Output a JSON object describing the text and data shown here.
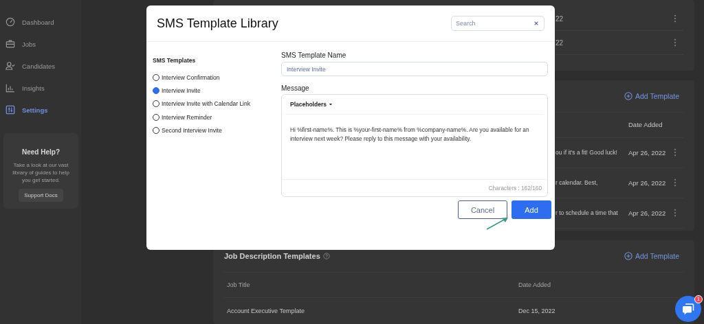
{
  "sidebar": {
    "items": [
      {
        "label": "Dashboard",
        "kind": "dashboard",
        "selected": false
      },
      {
        "label": "Jobs",
        "kind": "jobs",
        "selected": false
      },
      {
        "label": "Candidates",
        "kind": "candidates",
        "selected": false
      },
      {
        "label": "Insights",
        "kind": "insights",
        "selected": false
      },
      {
        "label": "Settings",
        "kind": "settings",
        "selected": true
      }
    ],
    "help_card": {
      "title": "Need Help?",
      "text": "Take a look at our vast library of guides to help you get started.",
      "button": "Support Docs"
    }
  },
  "top_table": {
    "rows": [
      {
        "date": "22"
      },
      {
        "date": "22"
      }
    ]
  },
  "sms_templates_section": {
    "add_button": "Add Template",
    "columns": [
      "Date Added"
    ],
    "rows": [
      {
        "message": "ou if it's a fit! Good luck!",
        "date": "Apr 26, 2022"
      },
      {
        "message": "r calendar. Best,",
        "date": "Apr 26, 2022"
      },
      {
        "message": "r to schedule a time that",
        "date": "Apr 26, 2022"
      }
    ]
  },
  "job_description_templates": {
    "title": "Job Description Templates",
    "add_button": "Add Template",
    "columns": [
      "Job Title",
      "Date Added"
    ],
    "rows": [
      {
        "job_title": "Account Executive Template",
        "date": "Dec 15, 2022"
      }
    ]
  },
  "modal": {
    "title": "SMS Template Library",
    "search": {
      "placeholder": "Search"
    },
    "list_title": "SMS Templates",
    "templates": [
      {
        "label": "Interview Confirmation",
        "selected": false
      },
      {
        "label": "Interview Invite",
        "selected": true
      },
      {
        "label": "Interview Invite with Calendar Link",
        "selected": false
      },
      {
        "label": "Interview Reminder",
        "selected": false
      },
      {
        "label": "Second Interview Invite",
        "selected": false
      }
    ],
    "name_label": "SMS Template Name",
    "name_value": "Interview Invite",
    "message_label": "Message",
    "placeholders_button": "Placeholders",
    "message": "Hi %first-name%. This is %your-first-name% from %company-name%. Are you available for an interview next week? Please reply to this message with your availability.",
    "character_count": "Characters : 162/160",
    "cancel_button": "Cancel",
    "add_button": "Add"
  },
  "chat": {
    "badge": "1"
  }
}
